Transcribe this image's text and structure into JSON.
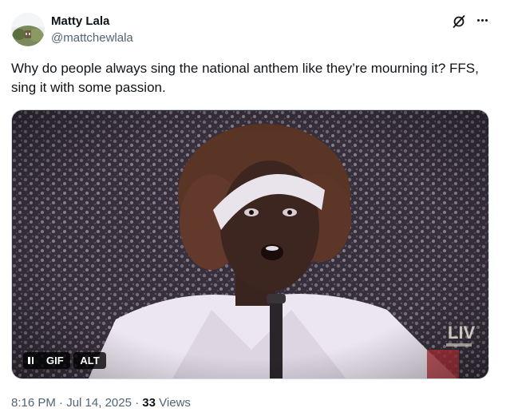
{
  "author": {
    "name": "Matty Lala",
    "handle": "@mattchewlala",
    "avatar_icon": "avatar-photo"
  },
  "header_actions": {
    "grok_icon": "grok-icon",
    "more_icon": "more-icon"
  },
  "tweet": {
    "text": "Why do people always sing the national anthem like they’re mourning it? FFS, sing it with some passion."
  },
  "media": {
    "type": "gif",
    "pause_icon": "pause-icon",
    "gif_label": "GIF",
    "alt_label": "ALT",
    "watermark": "LIV"
  },
  "meta": {
    "time": "8:16 PM",
    "separator": "·",
    "date": "Jul 14, 2025",
    "views_count": "33",
    "views_label": "Views"
  },
  "colors": {
    "text": "#0f1419",
    "secondary_text": "#536471",
    "border": "#cfd9de",
    "badge_bg": "#000000"
  }
}
